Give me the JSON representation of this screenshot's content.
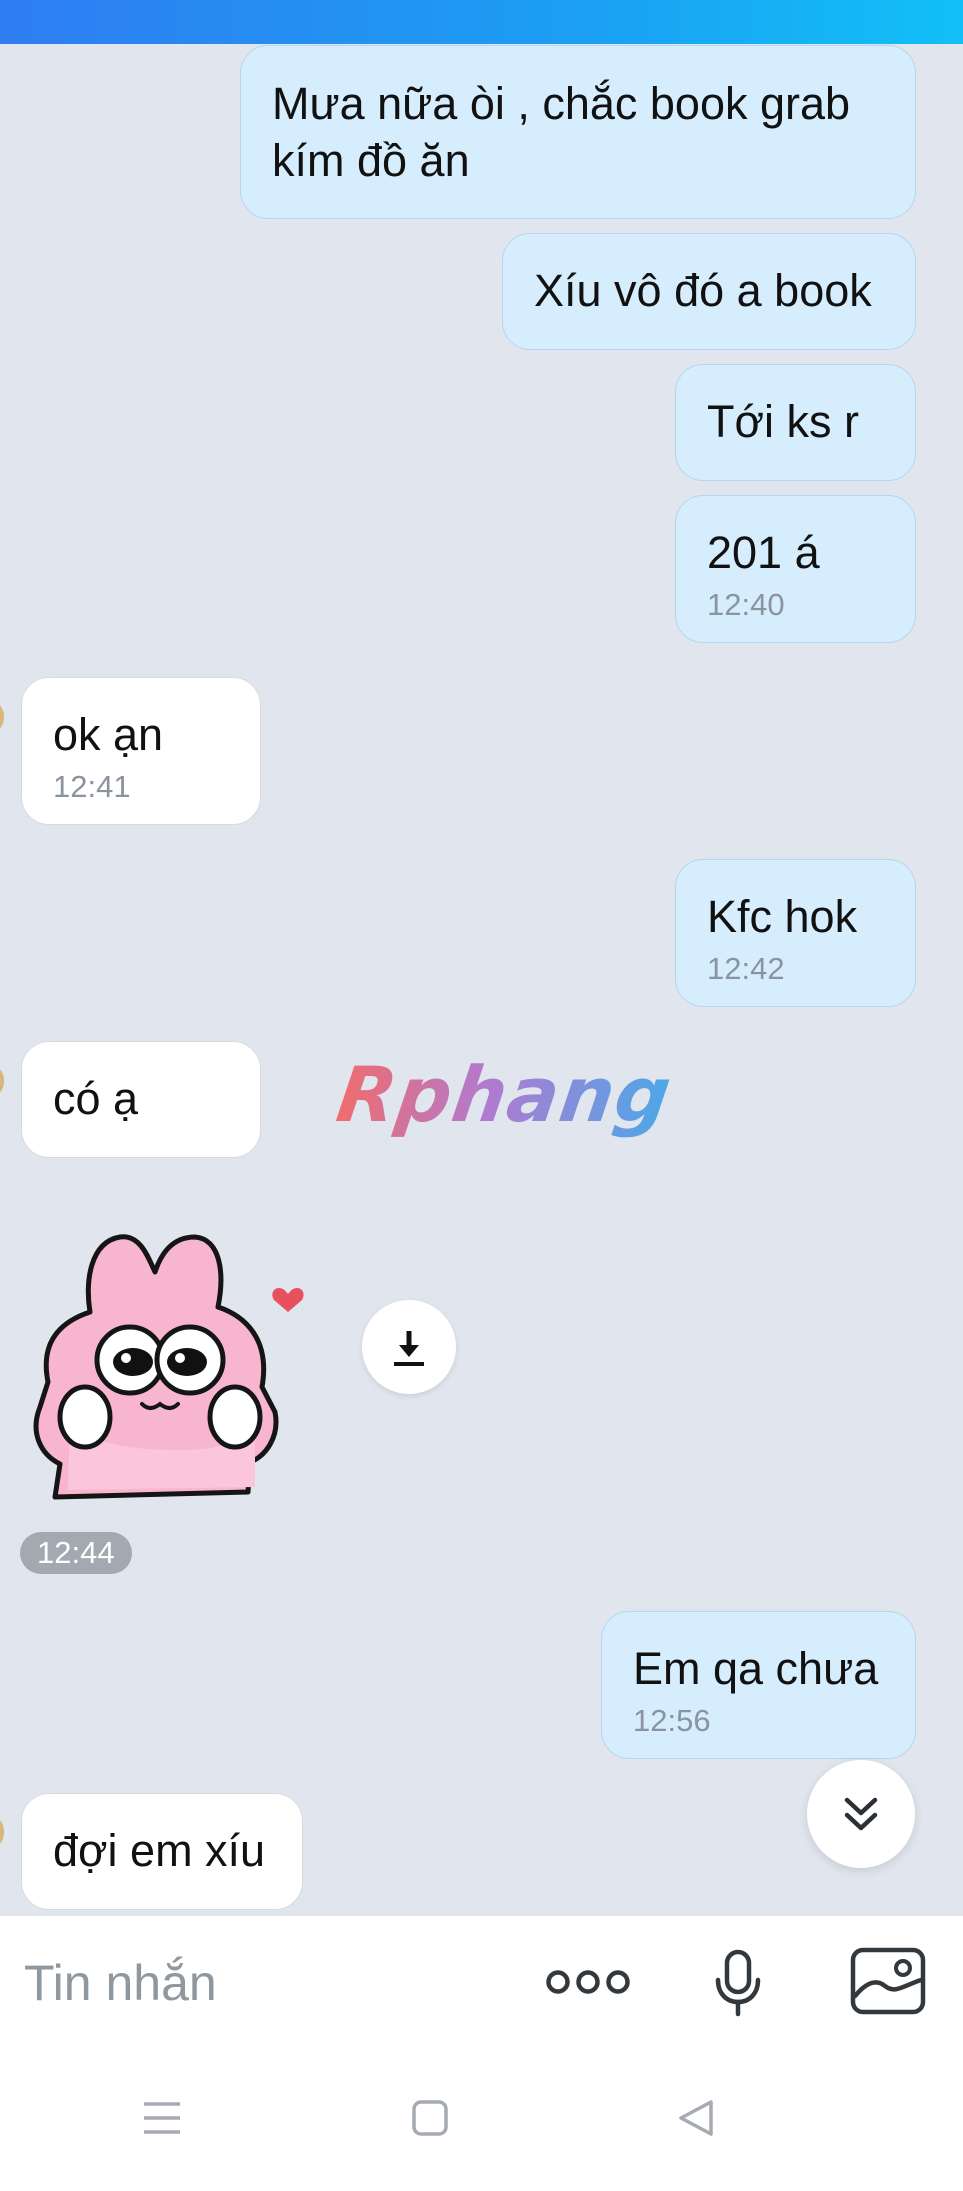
{
  "messages": [
    {
      "dir": "sent",
      "text": "Mưa nữa òi , chắc book grab kím đồ ăn"
    },
    {
      "dir": "sent",
      "text": "Xíu vô đó a book"
    },
    {
      "dir": "sent",
      "text": "Tới ks r"
    },
    {
      "dir": "sent",
      "text": "201 á",
      "time": "12:40"
    },
    {
      "dir": "received",
      "text": "ok ạn",
      "time": "12:41"
    },
    {
      "dir": "sent",
      "text": "Kfc hok",
      "time": "12:42"
    },
    {
      "dir": "received",
      "text": "có ạ"
    },
    {
      "dir": "received",
      "type": "sticker",
      "time": "12:44"
    },
    {
      "dir": "sent",
      "text": "Em qa chưa",
      "time": "12:56"
    },
    {
      "dir": "received",
      "text": "đợi em xíu"
    }
  ],
  "watermark": "Rphang",
  "composer": {
    "placeholder": "Tin nhắn"
  },
  "icons": {
    "download": "download-icon",
    "scroll_down": "double-chevron-down-icon",
    "more": "more-dots-icon",
    "mic": "microphone-icon",
    "image": "image-icon",
    "nav_menu": "menu-icon",
    "nav_home": "home-square-icon",
    "nav_back": "back-triangle-icon"
  },
  "colors": {
    "header_gradient_start": "#2f7df2",
    "header_gradient_end": "#12c0f7",
    "sent_bubble": "#d5edfd",
    "received_bubble": "#ffffff",
    "chat_background": "#e1e6ee"
  }
}
